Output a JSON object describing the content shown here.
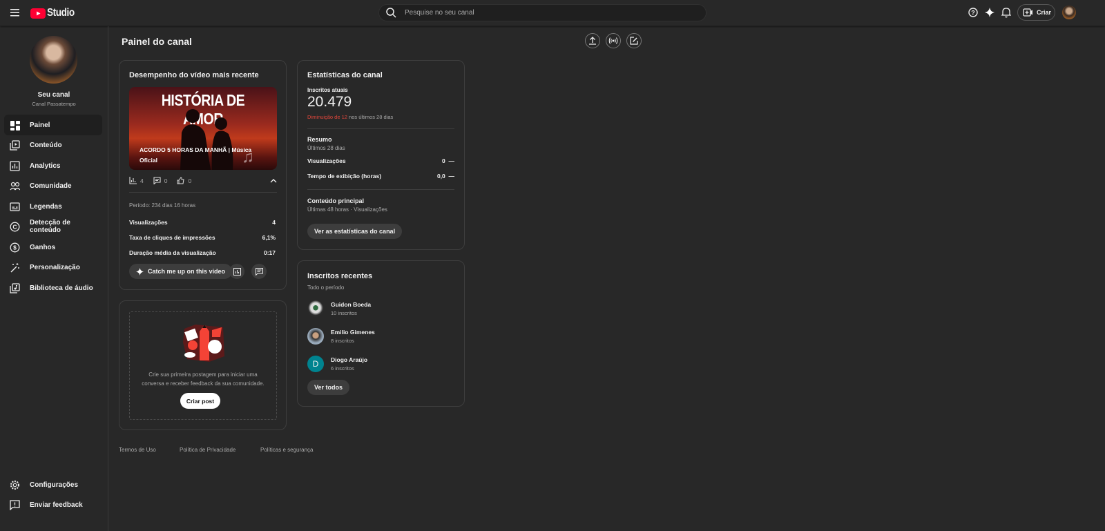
{
  "header": {
    "logo_text": "Studio",
    "search_placeholder": "Pesquise no seu canal",
    "create_label": "Criar"
  },
  "sidebar": {
    "channel_name": "Seu canal",
    "channel_subtitle": "Canal Passatempo",
    "items": [
      {
        "label": "Painel",
        "icon": "dashboard-icon"
      },
      {
        "label": "Conteúdo",
        "icon": "content-icon"
      },
      {
        "label": "Analytics",
        "icon": "analytics-icon"
      },
      {
        "label": "Comunidade",
        "icon": "community-icon"
      },
      {
        "label": "Legendas",
        "icon": "subtitles-icon"
      },
      {
        "label": "Detecção de conteúdo",
        "icon": "copyright-icon"
      },
      {
        "label": "Ganhos",
        "icon": "dollar-icon"
      },
      {
        "label": "Personalização",
        "icon": "magic-wand-icon"
      },
      {
        "label": "Biblioteca de áudio",
        "icon": "audio-library-icon"
      }
    ],
    "bottom": [
      {
        "label": "Configurações"
      },
      {
        "label": "Enviar feedback"
      }
    ]
  },
  "page": {
    "title": "Painel do canal"
  },
  "video_card": {
    "title": "Desempenho do vídeo mais recente",
    "thumb_heading": "HISTÓRIA DE AMOR",
    "video_title": "ACORDO 5 HORAS DA MANHÃ | Música Oficial",
    "views": "4",
    "comments": "0",
    "likes": "0",
    "period": "Período: 234 dias 16 horas",
    "metrics": [
      {
        "label": "Visualizações",
        "value": "4"
      },
      {
        "label": "Taxa de cliques de impressões",
        "value": "6,1%"
      },
      {
        "label": "Duração média da visualização",
        "value": "0:17"
      }
    ],
    "catch_up_label": "Catch me up on this video"
  },
  "post_card": {
    "text": "Crie sua primeira postagem para iniciar uma conversa e receber feedback da sua comunidade.",
    "button": "Criar post"
  },
  "stats_card": {
    "title": "Estatísticas do canal",
    "subs_label": "Inscritos atuais",
    "subs_value": "20.479",
    "change_red": "Diminuição de 12",
    "change_rest": " nos últimos 28 dias",
    "summary_title": "Resumo",
    "summary_period": "Últimos 28 dias",
    "summary": [
      {
        "label": "Visualizações",
        "value": "0",
        "trend": "—"
      },
      {
        "label": "Tempo de exibição (horas)",
        "value": "0,0",
        "trend": "—"
      }
    ],
    "top_title": "Conteúdo principal",
    "top_sub": "Últimas 48 horas · Visualizações",
    "button": "Ver as estatísticas do canal"
  },
  "subs_card": {
    "title": "Inscritos recentes",
    "period": "Todo o período",
    "items": [
      {
        "name": "Guidon Boeda",
        "count": "10 inscritos"
      },
      {
        "name": "Emilio Gimenes",
        "count": "8 inscritos"
      },
      {
        "name": "Diogo Araújo",
        "count": "6 inscritos",
        "initial": "D"
      }
    ],
    "button": "Ver todos"
  },
  "footer": {
    "links": [
      "Termos de Uso",
      "Política de Privacidade",
      "Políticas e segurança"
    ]
  },
  "colors": {
    "accent_red": "#ff0033",
    "decrease": "#e5473b",
    "avatar_teal": "#00838f"
  }
}
